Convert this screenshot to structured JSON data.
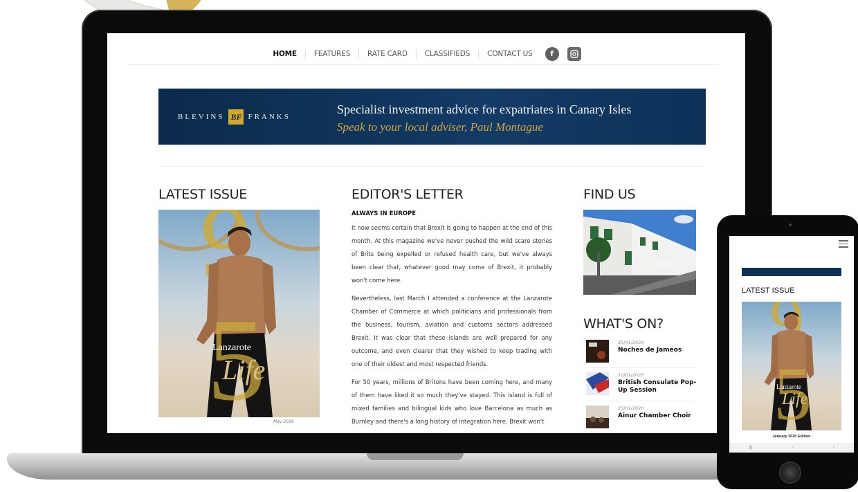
{
  "nav": {
    "items": [
      "HOME",
      "FEATURES",
      "RATE CARD",
      "CLASSIFIEDS",
      "CONTACT US"
    ],
    "facebook_glyph": "f",
    "icons": [
      "facebook-icon",
      "instagram-icon"
    ]
  },
  "banner": {
    "brand_left": "BLEVINS",
    "brand_mark": "BF",
    "brand_right": "FRANKS",
    "line1": "Specialist investment advice for expatriates in Canary Isles",
    "line2": "Speak to your local adviser, Paul Montague"
  },
  "latest_issue": {
    "title": "LATEST ISSUE",
    "cover_brand": "Lanzarote",
    "cover_life": "Life",
    "caption": "May 2019"
  },
  "editor": {
    "title": "EDITOR'S LETTER",
    "subtitle": "ALWAYS IN EUROPE",
    "paragraphs": [
      "It now seems certain that Brexit is going to happen at the end of this month. At this magazine we've never pushed the wild scare stories of Brits being expelled or refused health care, but we've always been clear that, whatever good may come of Brexit, it probably won't come here.",
      "Nevertheless, last March I attended a conference at the Lanzarote Chamber of Commerce at which politicians and professionals from the business, tourism, aviation and customs sectors addressed Brexit. It was clear that these islands are well prepared for any outcome, and even clearer that they wished to keep trading with one of their oldest and most respected friends.",
      "For 50 years, millions of Britons have been coming here, and many of them have liked it so much they've stayed. This island is full of mixed families and bilingual kids who love Barcelona as much as Burnley and there's a long history of integration here. Brexit won't"
    ]
  },
  "find_us": {
    "title": "FIND US"
  },
  "whats_on": {
    "title": "WHAT'S ON?",
    "items": [
      {
        "date": "25/01/2020",
        "title": "Noches de Jameos"
      },
      {
        "date": "10/01/2020",
        "title": "British Consulate Pop-Up Session"
      },
      {
        "date": "25/01/2020",
        "title": "Ainur Chamber Choir"
      }
    ]
  },
  "tablet": {
    "title": "LATEST ISSUE",
    "caption": "January 2020 Edition",
    "cover_brand": "Lanzarote",
    "cover_life": "Life",
    "nav_glyphs": [
      "|||",
      "○",
      "‹"
    ]
  },
  "colors": {
    "banner_navy": "#0b2a4a",
    "banner_gold": "#d6a53a",
    "cover_gold": "#ccaa3c"
  }
}
